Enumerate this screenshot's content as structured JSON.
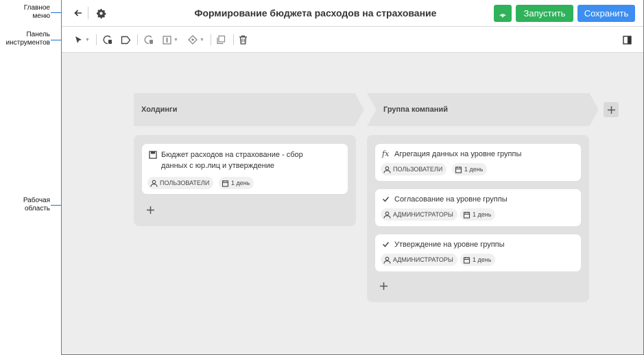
{
  "callouts": {
    "main_menu": "Главное меню",
    "toolbar": "Панель инструментов",
    "workspace": "Рабочая область"
  },
  "header": {
    "title": "Формирование бюджета расходов на страхование",
    "run_label": "Запустить",
    "save_label": "Сохранить"
  },
  "colors": {
    "green": "#2fb25a",
    "blue": "#3d8ef0",
    "callout": "#1a73c8"
  },
  "lanes": [
    {
      "title": "Холдинги",
      "cards": [
        {
          "icon": "save-icon",
          "title_line1": "Бюджет расходов на страхование - сбор",
          "title_line2": "данных с юр.лиц и утверждение",
          "role": "ПОЛЬЗОВАТЕЛИ",
          "duration": "1 день"
        }
      ]
    },
    {
      "title": "Группа компаний",
      "cards": [
        {
          "icon": "function-icon",
          "icon_text": "fx",
          "title_line1": "Агрегация данных на уровне группы",
          "role": "ПОЛЬЗОВАТЕЛИ",
          "duration": "1 день"
        },
        {
          "icon": "check-icon",
          "title_line1": "Согласование на уровне группы",
          "role": "АДМИНИСТРАТОРЫ",
          "duration": "1 день"
        },
        {
          "icon": "check-icon",
          "title_line1": "Утверждение на уровне группы",
          "role": "АДМИНИСТРАТОРЫ",
          "duration": "1 день"
        }
      ]
    }
  ]
}
